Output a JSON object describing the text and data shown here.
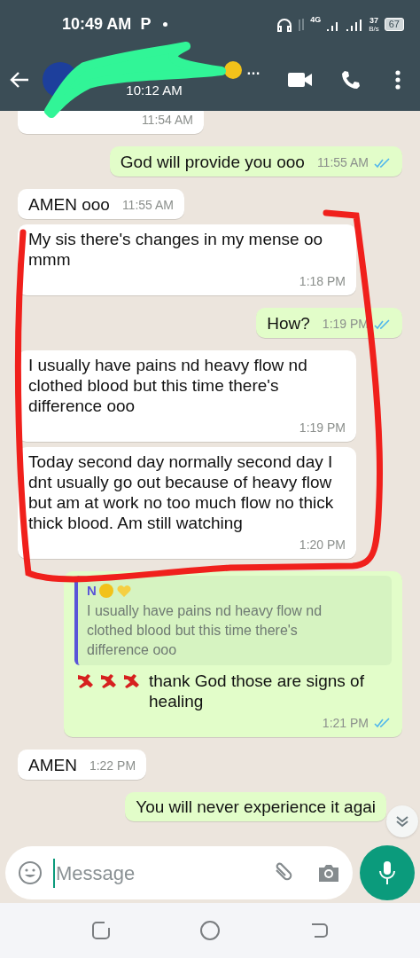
{
  "status_bar": {
    "time": "10:49 AM",
    "notification": "P",
    "network": "4G",
    "speed_value": "37",
    "speed_unit": "B/s",
    "battery": "67"
  },
  "header": {
    "name_tail": "…",
    "subtitle": "10:12 AM"
  },
  "messages": [
    {
      "kind": "incoming",
      "time": "11:54 AM"
    },
    {
      "kind": "outgoing",
      "text": "God will provide you ooo",
      "time": "11:55 AM",
      "read": true
    },
    {
      "kind": "incoming",
      "text": "AMEN ooo",
      "time": "11:55 AM"
    },
    {
      "kind": "incoming",
      "text": "My sis there's changes in my mense oo mmm",
      "time": "1:18 PM"
    },
    {
      "kind": "outgoing",
      "text": "How?",
      "time": "1:19 PM",
      "read": true
    },
    {
      "kind": "incoming",
      "text": "I usually have pains nd heavy flow nd clothed blood but this time there's difference ooo",
      "time": "1:19 PM"
    },
    {
      "kind": "incoming",
      "text": "Today second day normally second day I dnt usually go out because of heavy flow but am at work no too much flow no thick thick blood. Am still watching",
      "time": "1:20 PM"
    },
    {
      "kind": "outgoing",
      "quote": {
        "name_tail": "N",
        "text": "I usually have pains nd heavy flow nd clothed blood but this time there's difference ooo"
      },
      "text": "thank God those are signs of healing",
      "time": "1:21 PM",
      "read": true
    },
    {
      "kind": "incoming",
      "text": "AMEN",
      "time": "1:22 PM"
    },
    {
      "kind": "outgoing",
      "text": "You will never experience it agai"
    }
  ],
  "composer": {
    "placeholder": "Message"
  }
}
